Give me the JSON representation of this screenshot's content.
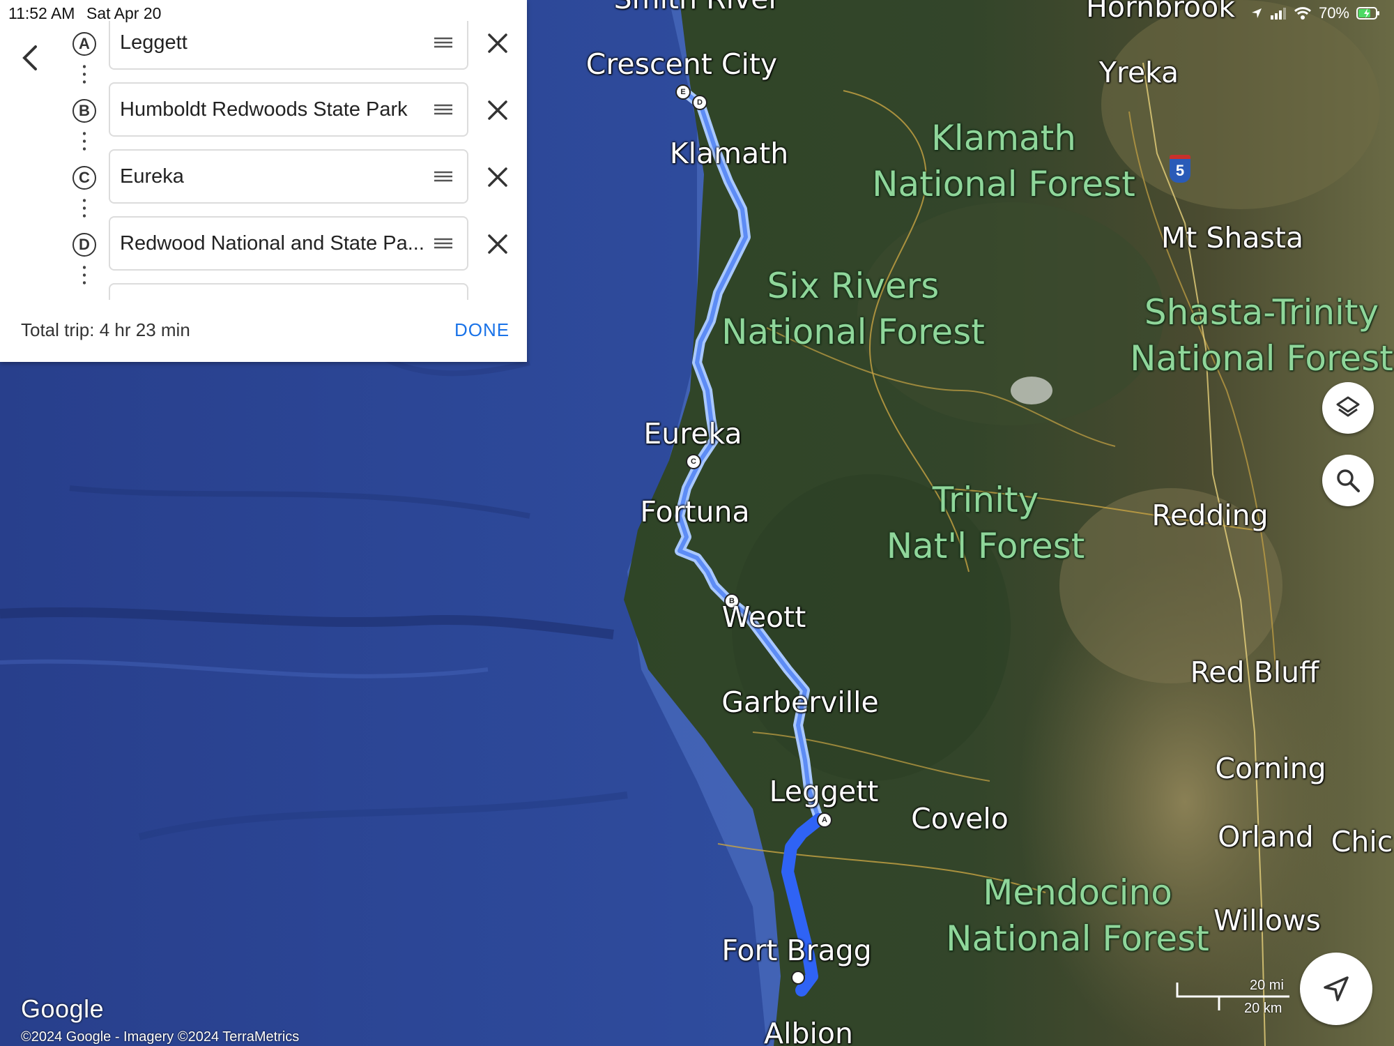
{
  "status_bar": {
    "time": "11:52 AM",
    "date": "Sat Apr 20",
    "battery": "70%"
  },
  "directions": {
    "stops": [
      {
        "letter": "A",
        "name": "Leggett"
      },
      {
        "letter": "B",
        "name": "Humboldt Redwoods State Park"
      },
      {
        "letter": "C",
        "name": "Eureka"
      },
      {
        "letter": "D",
        "name": "Redwood National and State Pa..."
      }
    ],
    "total_trip": "Total trip: 4 hr 23 min",
    "done_label": "DONE"
  },
  "map": {
    "places": {
      "smith_river": "Smith River",
      "hornbrook": "Hornbrook",
      "crescent_city": "Crescent City",
      "yreka": "Yreka",
      "klamath": "Klamath",
      "mt_shasta": "Mt Shasta",
      "eureka": "Eureka",
      "fortuna": "Fortuna",
      "weott": "Weott",
      "garberville": "Garberville",
      "leggett": "Leggett",
      "covelo": "Covelo",
      "redding": "Redding",
      "red_bluff": "Red Bluff",
      "corning": "Corning",
      "orland": "Orland",
      "chico": "Chic",
      "willows": "Willows",
      "fort_bragg": "Fort Bragg",
      "albion": "Albion"
    },
    "forests": {
      "klamath_1": "Klamath",
      "klamath_2": "National Forest",
      "six_rivers_1": "Six Rivers",
      "six_rivers_2": "National Forest",
      "shasta_1": "Shasta-Trinity",
      "shasta_2": "National Forest",
      "trinity_1": "Trinity",
      "trinity_2": "Nat'l Forest",
      "mendocino_1": "Mendocino",
      "mendocino_2": "National Forest"
    },
    "route_markers": [
      "A",
      "B",
      "C",
      "D",
      "E"
    ],
    "highway_shield": "5",
    "route_color": "#2f63f5",
    "route_outline_color": "#a9c8ff",
    "scale_mi": "20 mi",
    "scale_km": "20 km",
    "logo": "Google",
    "copyright": "©2024 Google - Imagery ©2024 TerraMetrics"
  },
  "buttons": {
    "layers": "layers-icon",
    "search": "search-icon",
    "my_location": "navigation-arrow-icon"
  }
}
